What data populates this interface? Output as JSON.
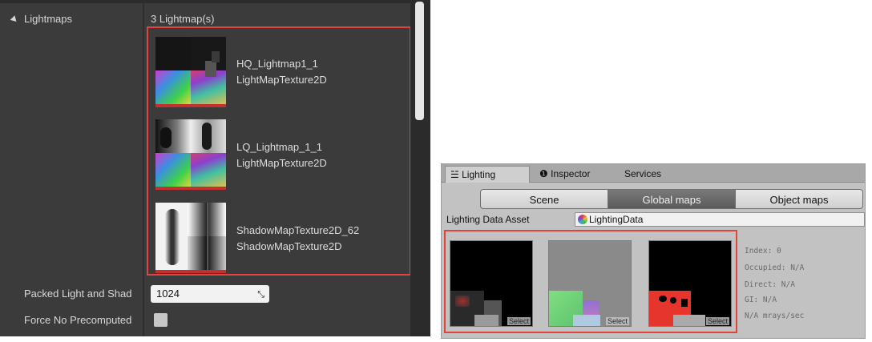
{
  "unreal": {
    "section_label": "Lightmaps",
    "count_label": "3 Lightmap(s)",
    "lightmaps": [
      {
        "name": "HQ_Lightmap1_1",
        "type": "LightMapTexture2D"
      },
      {
        "name": "LQ_Lightmap_1_1",
        "type": "LightMapTexture2D"
      },
      {
        "name": "ShadowMapTexture2D_62",
        "type": "ShadowMapTexture2D"
      }
    ],
    "packed_label": "Packed Light and Shad",
    "packed_value": "1024",
    "force_label": "Force No Precomputed"
  },
  "unity": {
    "tabs": [
      {
        "icon": "sliders-icon",
        "glyph": "☱",
        "label": "Lighting"
      },
      {
        "icon": "info-icon",
        "glyph": "❶",
        "label": "Inspector"
      },
      {
        "icon": "",
        "glyph": "",
        "label": "Services"
      }
    ],
    "modes": [
      "Scene",
      "Global maps",
      "Object maps"
    ],
    "selected_mode": "Global maps",
    "asset_label": "Lighting Data Asset",
    "asset_value": "LightingData",
    "select_label": "Select",
    "info": {
      "index": "Index: 0",
      "occupied": "Occupied: N/A",
      "direct": "Direct: N/A",
      "gi": "GI: N/A",
      "mrays": "N/A mrays/sec"
    }
  },
  "colors": {
    "highlight_red": "#e0453b",
    "unreal_panel": "#3b3b3b",
    "unity_panel": "#c2c2c2"
  }
}
